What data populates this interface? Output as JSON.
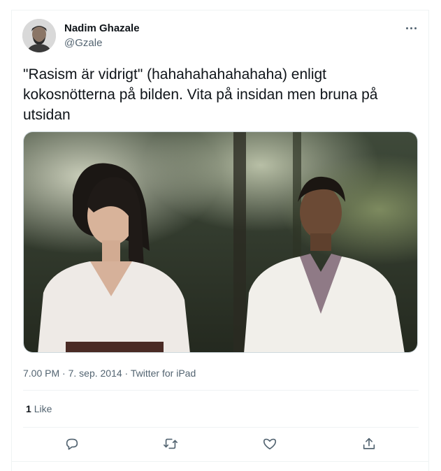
{
  "tweet": {
    "author_name": "Nadim Ghazale",
    "author_handle": "@Gzale",
    "text": "\"Rasism är vidrigt\" (hahahahahahahaha) enligt kokosnötterna på bilden. Vita på insidan men bruna på utsidan",
    "time": "7.00 PM",
    "date": "7. sep. 2014",
    "source": "Twitter for iPad",
    "separator": " · ",
    "likes_count": "1",
    "likes_label": "Like"
  },
  "icons": {
    "more": "more-horizontal-icon",
    "reply": "reply-icon",
    "retweet": "retweet-icon",
    "like": "heart-icon",
    "share": "share-icon"
  },
  "colors": {
    "primary_text": "#0f1419",
    "secondary_text": "#536471",
    "divider": "#eff3f4"
  }
}
